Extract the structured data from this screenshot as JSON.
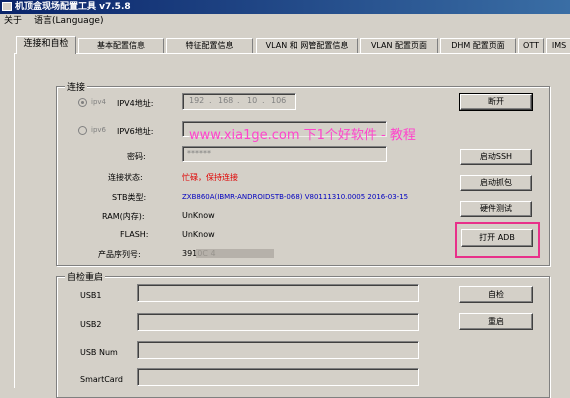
{
  "window": {
    "title": "机顶盒现场配置工具 v7.5.8"
  },
  "menu": {
    "about": "关于",
    "language": "语言(Language)"
  },
  "tabs": [
    "连接和自检",
    "基本配置信息",
    "特征配置信息",
    "VLAN 和 网管配置信息",
    "VLAN 配置页面",
    "DHM 配置页面",
    "OTT",
    "IMS"
  ],
  "connect": {
    "group_title": "连接",
    "ipv4_radio": "ipv4",
    "ipv4_label": "IPV4地址:",
    "ipv4_octets": [
      "192",
      "168",
      "10",
      "106"
    ],
    "ipv6_radio": "ipv6",
    "ipv6_label": "IPV6地址:",
    "password_label": "密码:",
    "password_value": "******",
    "status_label": "连接状态:",
    "status_value": "忙碌，保持连接",
    "stb_label": "STB类型:",
    "stb_value": "ZXB860A(IBMR-ANDROIDSTB-068) V80111310.0005 2016-03-15",
    "ram_label": "RAM(内存):",
    "ram_value": "UnKnow",
    "flash_label": "FLASH:",
    "flash_value": "UnKnow",
    "serial_label": "产品序列号:",
    "serial_value": "3910C                                        4"
  },
  "buttons": {
    "disconnect": "断开",
    "start_ssh": "启动SSH",
    "start_capture": "启动抓包",
    "hw_test": "硬件测试",
    "open_adb": "打开 ADB",
    "self_check": "自检",
    "restart": "重启"
  },
  "selfcheck": {
    "group_title": "自检重启",
    "usb1": "USB1",
    "usb2": "USB2",
    "usb_num": "USB Num",
    "smartcard": "SmartCard"
  },
  "watermark": "www.xia1ge.com 下1个好软件 - 教程"
}
